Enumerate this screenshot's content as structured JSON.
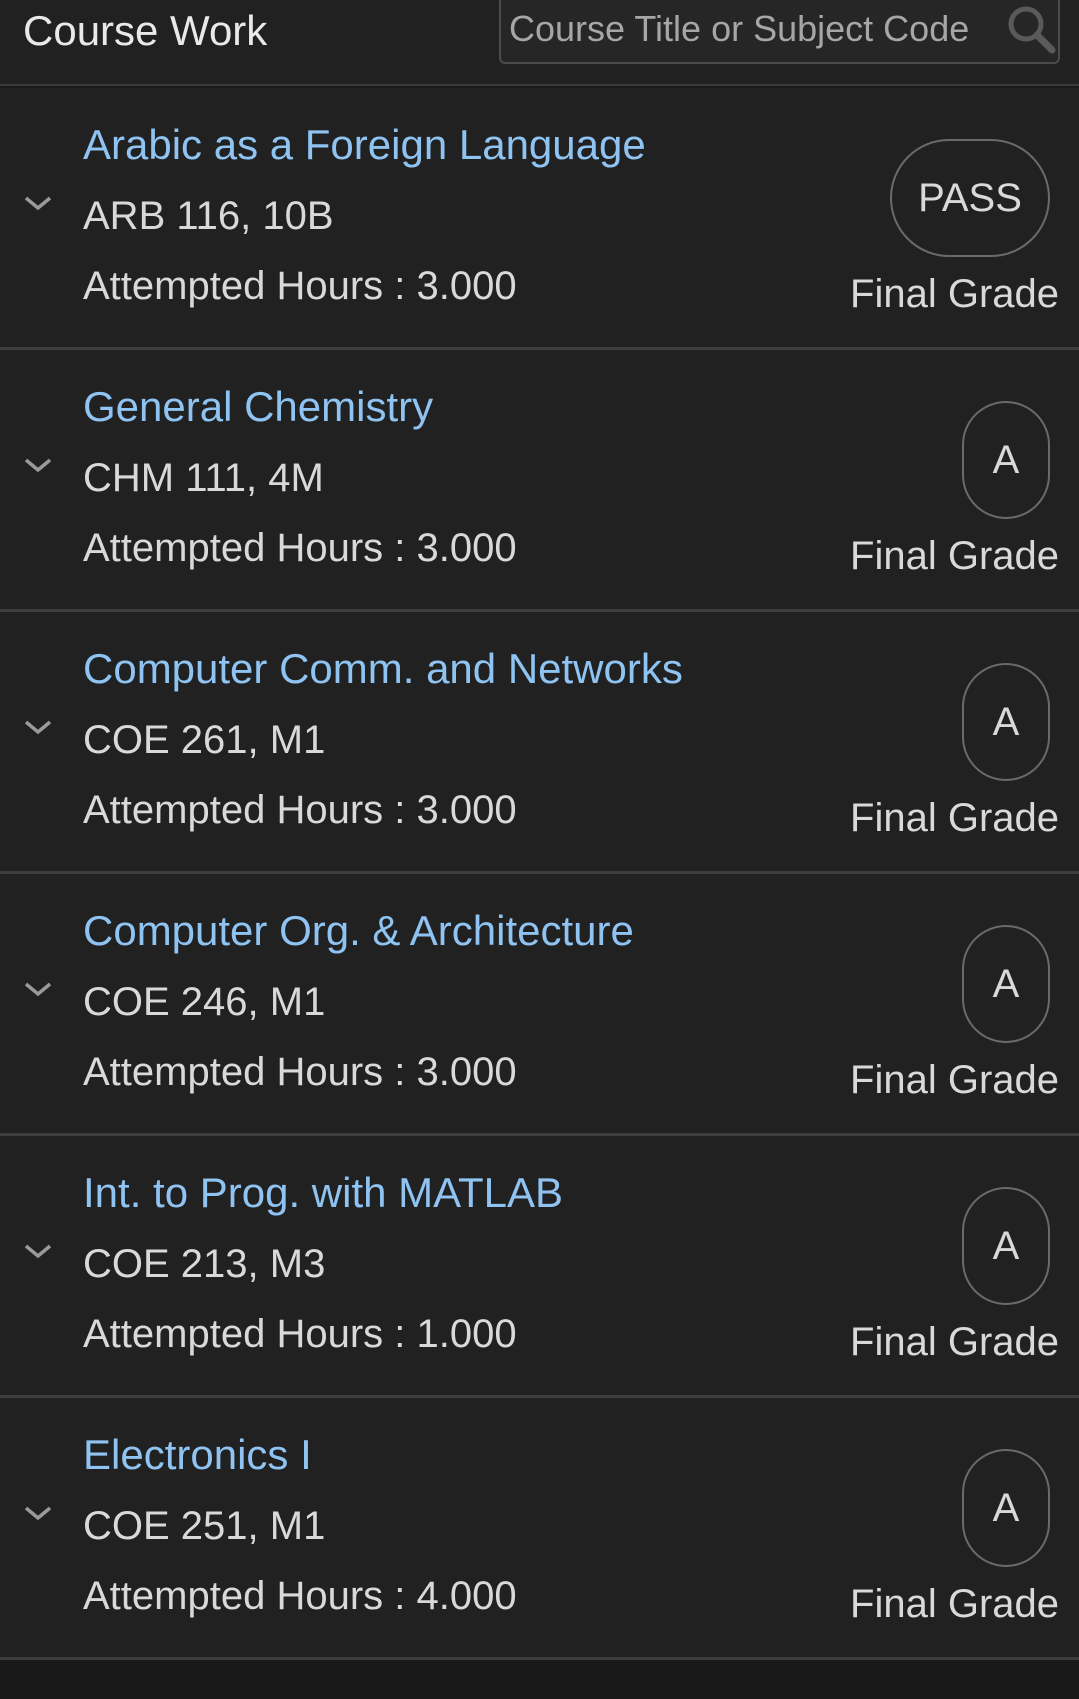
{
  "header": {
    "title": "Course Work",
    "search_placeholder": "Course Title or Subject Code"
  },
  "icons": {
    "search": "search-icon",
    "expand": "chevron-down-icon"
  },
  "colors": {
    "background": "#1a1a1a",
    "card": "#212121",
    "course_title": "#8fc3f2",
    "text": "#d9d9d9"
  },
  "courses": [
    {
      "title": "Arabic as a Foreign Language",
      "code": "ARB 116, 10B",
      "hours_label": "Attempted Hours",
      "hours_sep": ":",
      "hours": "3.000",
      "grade": "PASS",
      "grade_label": "Final Grade"
    },
    {
      "title": "General Chemistry",
      "code": "CHM 111, 4M",
      "hours_label": "Attempted Hours",
      "hours_sep": ":",
      "hours": "3.000",
      "grade": "A",
      "grade_label": "Final Grade"
    },
    {
      "title": "Computer Comm. and Networks",
      "code": "COE 261, M1",
      "hours_label": "Attempted Hours",
      "hours_sep": ":",
      "hours": "3.000",
      "grade": "A",
      "grade_label": "Final Grade"
    },
    {
      "title": "Computer Org. & Architecture",
      "code": "COE 246, M1",
      "hours_label": "Attempted Hours",
      "hours_sep": ":",
      "hours": "3.000",
      "grade": "A",
      "grade_label": "Final Grade"
    },
    {
      "title": "Int. to Prog. with MATLAB",
      "code": "COE 213, M3",
      "hours_label": "Attempted Hours",
      "hours_sep": ":",
      "hours": "1.000",
      "grade": "A",
      "grade_label": "Final Grade"
    },
    {
      "title": "Electronics I",
      "code": "COE 251, M1",
      "hours_label": "Attempted Hours",
      "hours_sep": ":",
      "hours": "4.000",
      "grade": "A",
      "grade_label": "Final Grade"
    }
  ]
}
